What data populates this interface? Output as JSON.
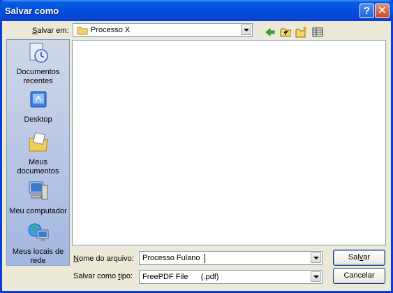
{
  "title": "Salvar como",
  "save_in": {
    "label": "Salvar em:",
    "label_ul": "S",
    "label_rest": "alvar em:",
    "value": "Processo X"
  },
  "places": [
    {
      "label": "Documentos recentes",
      "lines": [
        "Documentos",
        "recentes"
      ]
    },
    {
      "label": "Desktop",
      "lines": [
        "Desktop"
      ]
    },
    {
      "label": "Meus documentos",
      "lines": [
        "Meus",
        "documentos"
      ]
    },
    {
      "label": "Meu computador",
      "lines": [
        "Meu computador"
      ]
    },
    {
      "label": "Meus locais de rede",
      "lines": [
        "Meus locais de",
        "rede"
      ]
    }
  ],
  "filename": {
    "label": "Nome do arquivo:",
    "label_ul": "N",
    "label_rest": "ome do arquivo:",
    "value": "Processo Fulano"
  },
  "filetype": {
    "label": "Salvar como tipo:",
    "label_pre": "Salvar como ",
    "label_ul": "t",
    "label_rest": "ipo:",
    "value": "FreePDF File      (.pdf)"
  },
  "buttons": {
    "save": "Salvar",
    "save_pre": "Sal",
    "save_ul": "v",
    "save_rest": "ar",
    "cancel": "Cancelar"
  },
  "colors": {
    "titlebar": "#0050e0",
    "client": "#ece9d8",
    "accent_close": "#c94a1d"
  }
}
